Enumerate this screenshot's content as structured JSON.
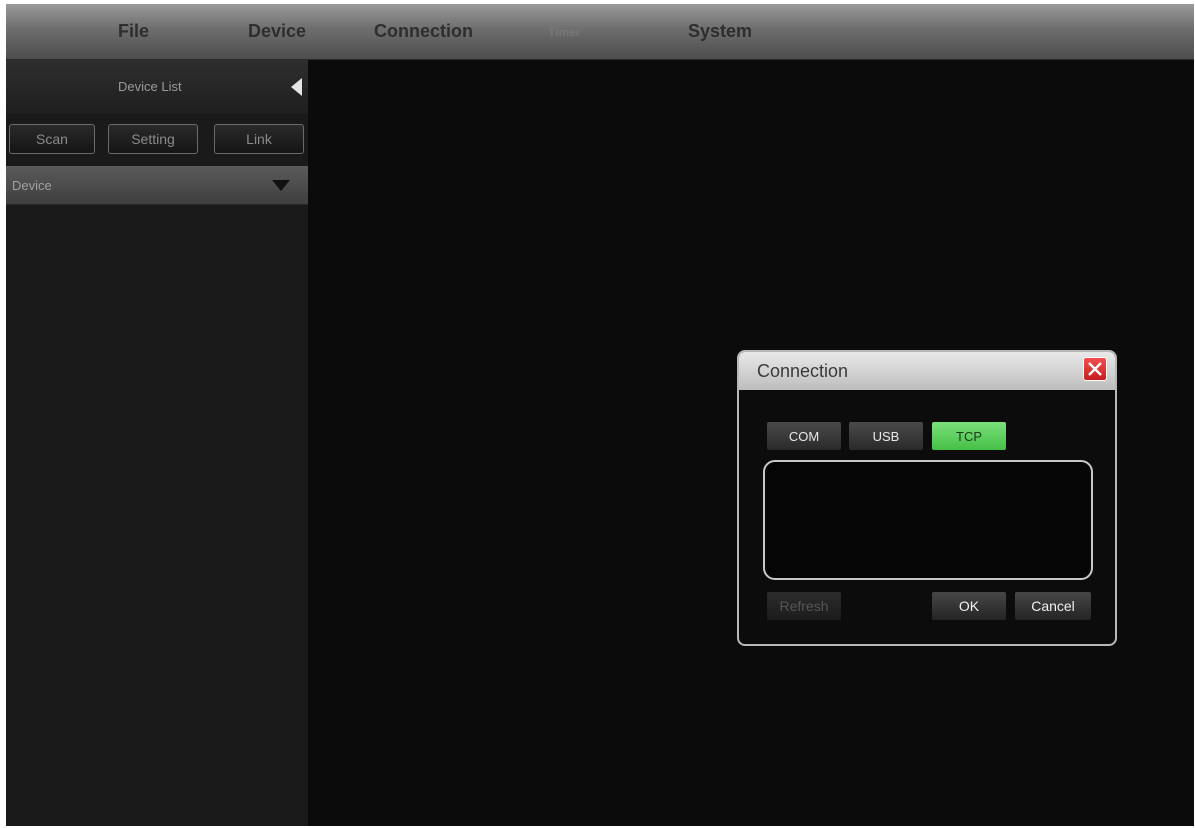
{
  "menu": {
    "items": [
      {
        "label": "File"
      },
      {
        "label": "Device"
      },
      {
        "label": "Connection"
      },
      {
        "label": "Timer"
      },
      {
        "label": "System"
      }
    ]
  },
  "sidebar": {
    "title": "Device List",
    "buttons": {
      "scan": "Scan",
      "setting": "Setting",
      "link": "Link"
    },
    "device_group": "Device"
  },
  "dialog": {
    "title": "Connection",
    "tabs": [
      {
        "label": "COM",
        "active": false
      },
      {
        "label": "USB",
        "active": false
      },
      {
        "label": "TCP",
        "active": true
      }
    ],
    "buttons": {
      "refresh": "Refresh",
      "ok": "OK",
      "cancel": "Cancel"
    }
  },
  "colors": {
    "active_tab": "#5fd35f",
    "close_button": "#e03c3c",
    "workspace": "#0b0b0c"
  }
}
